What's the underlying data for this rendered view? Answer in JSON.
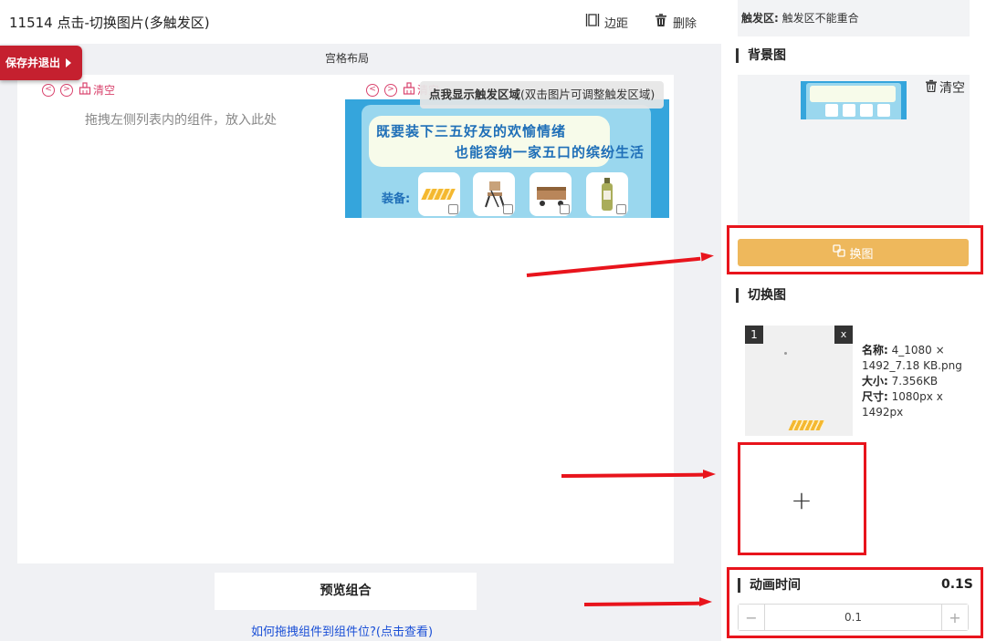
{
  "header": {
    "title": "11514 点击-切换图片(多触发区)",
    "margin_label": "边距",
    "delete_label": "删除"
  },
  "workspace": {
    "title": "宫格布局",
    "save_exit_label": "保存并退出",
    "clear_label_1": "清空",
    "clear_label_2": "清空",
    "drop_hint": "拖拽左侧列表内的组件，放入此处",
    "tooltip_bold": "点我显示触发区域",
    "tooltip_rest": "(双击图片可调整触发区域)",
    "banner": {
      "line1": "既要装下三五好友的欢愉情绪",
      "line2": "也能容纳一家五口的缤纷生活",
      "equip_label": "装备:"
    },
    "preview_label": "预览组合",
    "help_link": "如何拖拽组件到组件位?(点击查看)"
  },
  "panel": {
    "trigger_note_key": "触发区:",
    "trigger_note_text": "触发区不能重合",
    "bg_title": "背景图",
    "bg_clear_label": "清空",
    "change_label": "换图",
    "switch_title": "切换图",
    "thumb_index": "1",
    "thumb_close": "x",
    "meta": {
      "name_key": "名称:",
      "name_val": "4_1080 × 1492_7.18 KB.png",
      "size_key": "大小:",
      "size_val": "7.356KB",
      "dim_key": "尺寸:",
      "dim_val": "1080px x 1492px"
    },
    "add_symbol": "+",
    "anim_title": "动画时间",
    "anim_value": "0.1S",
    "anim_input": "0.1",
    "minus": "−",
    "plus": "+"
  },
  "colors": {
    "accent_red": "#c5202f",
    "change_button": "#eeb85c",
    "link_blue": "#1a4fd6",
    "annotation_red": "#e8141c",
    "clear_pink": "#d9446e"
  }
}
